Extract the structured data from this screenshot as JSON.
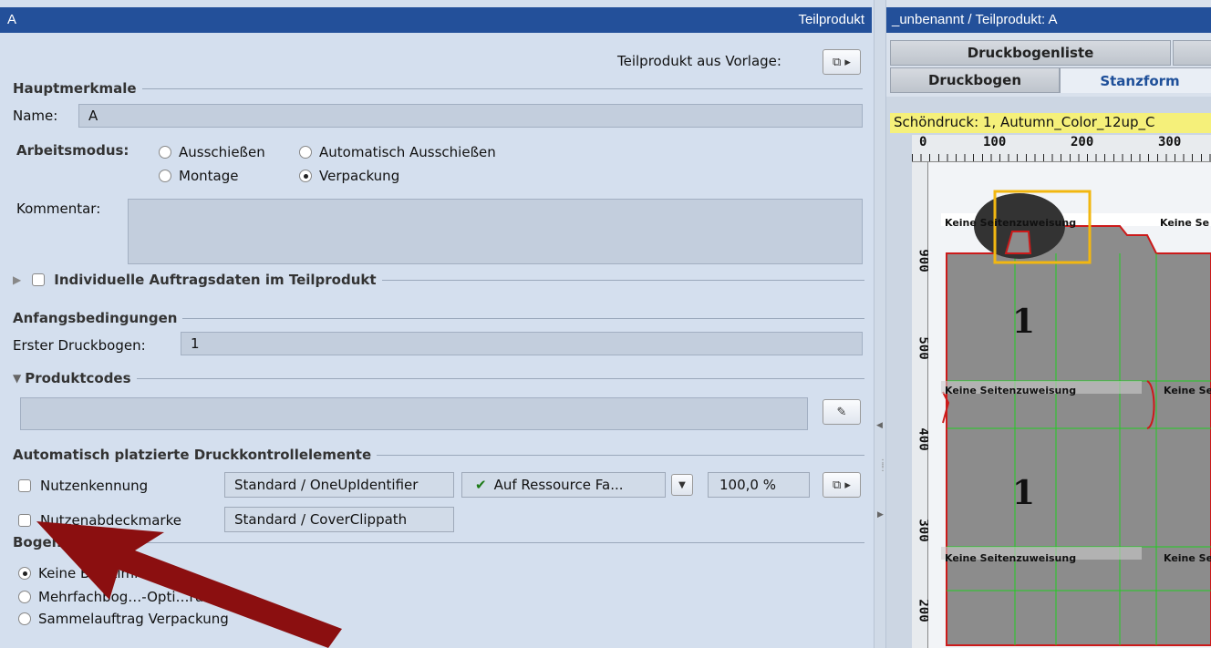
{
  "left_panel": {
    "title_left": "A",
    "title_right": "Teilprodukt",
    "template_label": "Teilprodukt aus Vorlage:",
    "main_section": "Hauptmerkmale",
    "name_label": "Name:",
    "name_value": "A",
    "mode_label": "Arbeitsmodus:",
    "mode_options": [
      "Ausschießen",
      "Automatisch Ausschießen",
      "Montage",
      "Verpackung"
    ],
    "comment_label": "Kommentar:",
    "individual_label": "Individuelle Auftragsdaten im Teilprodukt",
    "start_section": "Anfangsbedingungen",
    "first_sheet_label": "Erster Druckbogen:",
    "first_sheet_value": "1",
    "product_codes_section": "Produktcodes",
    "auto_section": "Automatisch platzierte Druckkontrollelemente",
    "row1": {
      "label": "Nutzenkennung",
      "value": "Standard / OneUpIdentifier",
      "resource": "Auf Ressource Fa...",
      "percent": "100,0 %"
    },
    "row2": {
      "label": "Nutzenabdeckmarke",
      "value": "Standard / CoverClippath"
    },
    "sheet_opt_section": "Bogen…ung",
    "sheet_opt_options": [
      "Keine Bo…timierung",
      "Mehrfachbog…-Opti…rung",
      "Sammelauftrag Verpackung"
    ]
  },
  "right_panel": {
    "title": "_unbenannt / Teilprodukt: A",
    "tabs_top": [
      "Druckbogenliste"
    ],
    "tabs_bottom": [
      "Druckbogen",
      "Stanzform"
    ],
    "info_bar": "Schöndruck:  1, Autumn_Color_12up_C",
    "ruler_h": [
      "0",
      "100",
      "200",
      "300"
    ],
    "ruler_v": [
      "900",
      "500",
      "400",
      "300",
      "200"
    ],
    "canvas_labels": [
      "Keine Seitenzuweisung",
      "Keine Se",
      "Keine Seitenzuweisung",
      "Keine Seite",
      "Keine Seitenzuweisung",
      "Keine Seite"
    ],
    "big_numbers": [
      "1",
      "1"
    ]
  },
  "colors": {
    "title_bar": "#23509a",
    "panel_bg": "#d4dfee",
    "arrow": "#8b0f10",
    "highlight_box": "#f2b711",
    "cut_line": "#cc1a1a",
    "fold_line": "#22cc22"
  }
}
